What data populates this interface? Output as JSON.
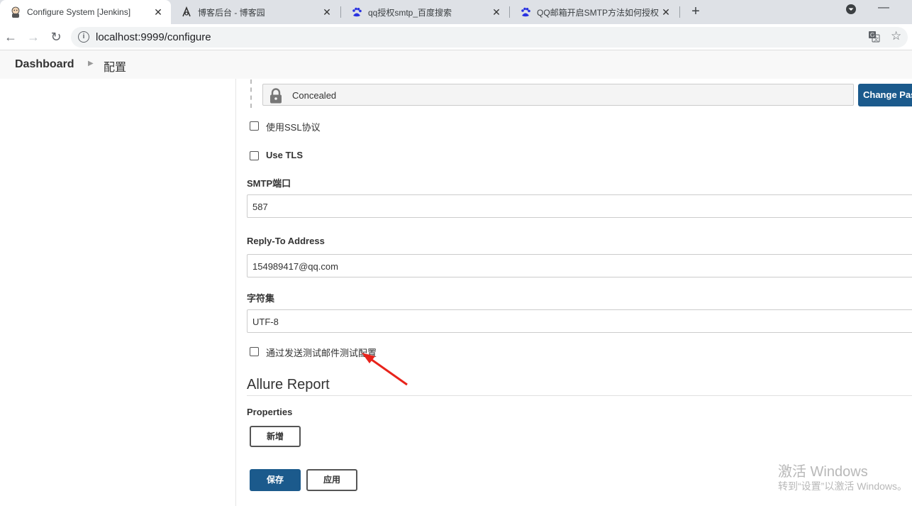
{
  "browser": {
    "tabs": [
      {
        "title": "Configure System [Jenkins]",
        "icon": "jenkins-icon"
      },
      {
        "title": "博客后台 - 博客园",
        "icon": "cnblogs-icon"
      },
      {
        "title": "qq授权smtp_百度搜索",
        "icon": "baidu-icon"
      },
      {
        "title": "QQ邮箱开启SMTP方法如何授权",
        "icon": "baidu-icon"
      }
    ],
    "url": "localhost:9999/configure"
  },
  "breadcrumb": {
    "home": "Dashboard",
    "current": "配置"
  },
  "form": {
    "password_value": "Concealed",
    "change_password_label": "Change Password",
    "ssl_label": "使用SSL协议",
    "tls_label": "Use TLS",
    "smtp_port_label": "SMTP端口",
    "smtp_port_value": "587",
    "reply_to_label": "Reply-To Address",
    "reply_to_value": "154989417@qq.com",
    "charset_label": "字符集",
    "charset_value": "UTF-8",
    "test_label": "通过发送测试邮件测试配置"
  },
  "allure": {
    "section_title": "Allure Report",
    "properties_label": "Properties",
    "add_label": "新增"
  },
  "actions": {
    "save_label": "保存",
    "apply_label": "应用"
  },
  "watermark": {
    "line1": "激活 Windows",
    "line2": "转到“设置”以激活 Windows。"
  },
  "colors": {
    "primary": "#1b5a8c",
    "annotation_arrow": "#e8231b"
  }
}
